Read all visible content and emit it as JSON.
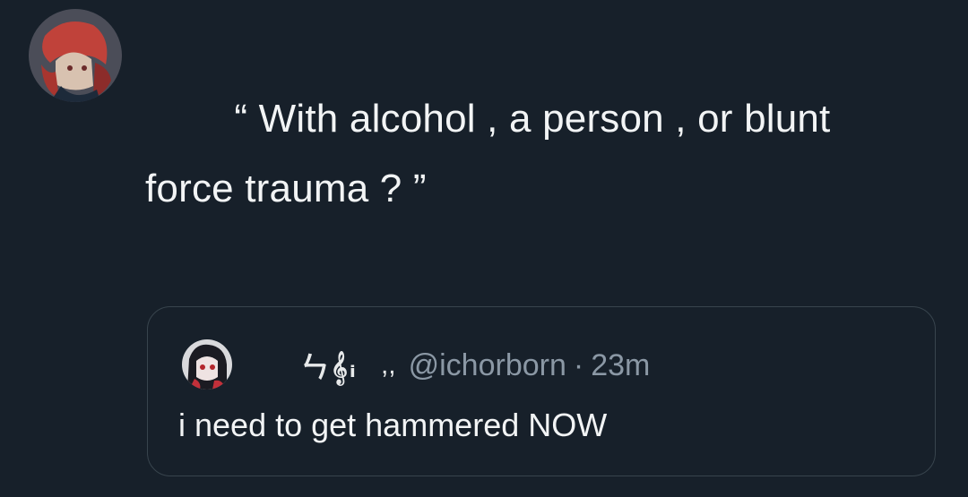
{
  "tweet": {
    "author_avatar_icon": "user-avatar-anime-red-hair",
    "text": "        “ With alcohol , a person , or blunt\nforce trauma ? ”"
  },
  "quoted_tweet": {
    "author_avatar_icon": "user-avatar-anime-dark-hair",
    "display_name": "ㄣ𝄞ᵢ",
    "display_name_suffix": ",,",
    "handle": "@ichorborn",
    "separator": "·",
    "timestamp": "23m",
    "text": "i need to get hammered NOW"
  },
  "colors": {
    "background": "#17202a",
    "text_primary": "#f2f4f5",
    "text_secondary": "#8b98a5",
    "border": "#38444d"
  }
}
